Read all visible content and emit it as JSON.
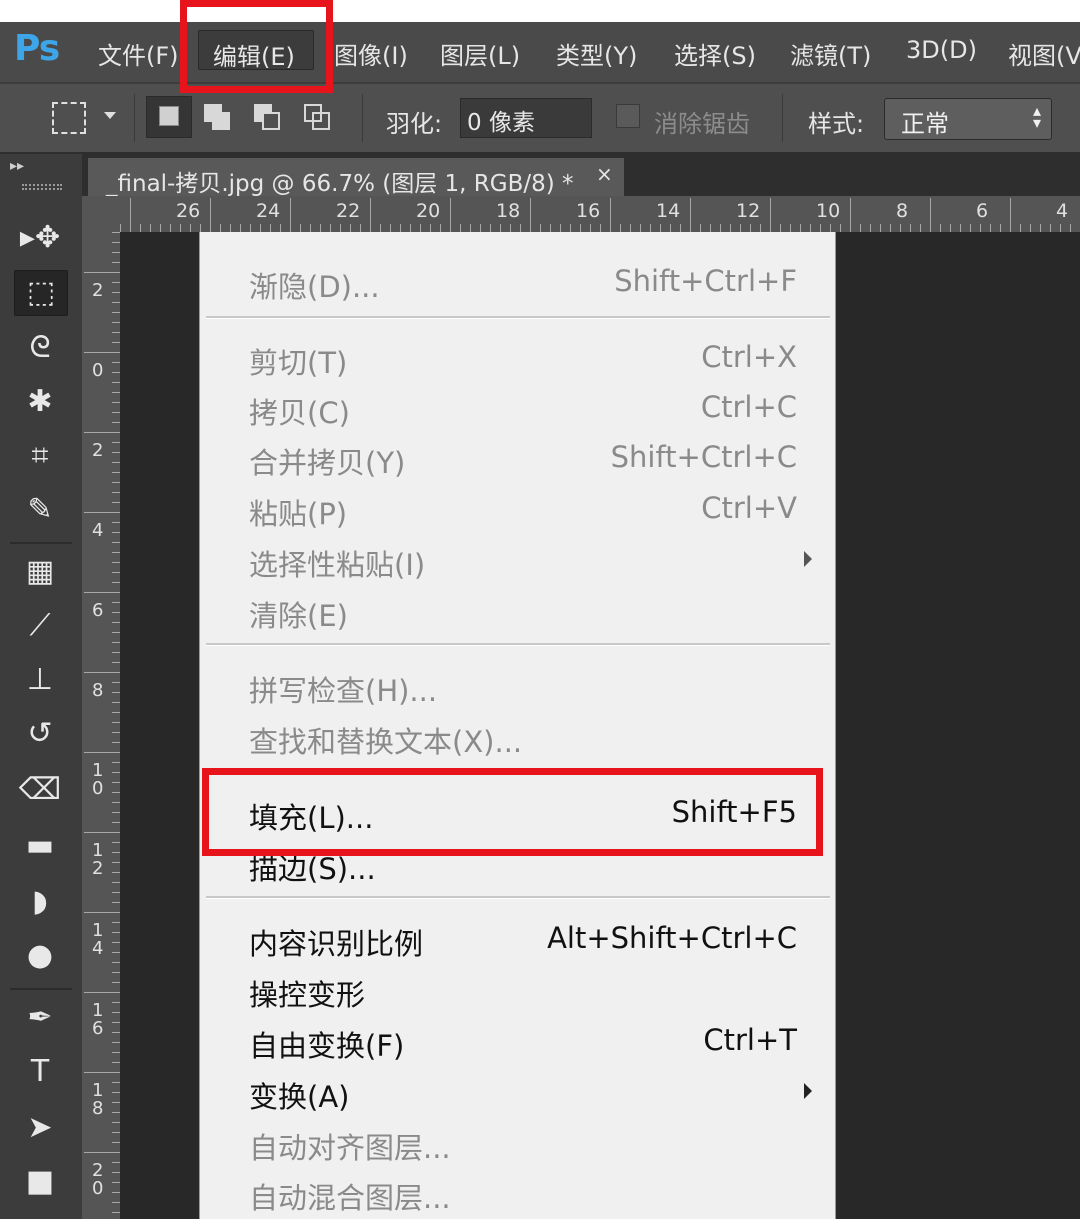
{
  "app": {
    "logo": "Ps"
  },
  "menubar": {
    "items": [
      {
        "label": "文件(F)"
      },
      {
        "label": "编辑(E)"
      },
      {
        "label": "图像(I)"
      },
      {
        "label": "图层(L)"
      },
      {
        "label": "类型(Y)"
      },
      {
        "label": "选择(S)"
      },
      {
        "label": "滤镜(T)"
      },
      {
        "label": "3D(D)"
      },
      {
        "label": "视图(V"
      }
    ]
  },
  "options": {
    "feather_label": "羽化:",
    "feather_value": "0 像素",
    "antialias_label": "消除锯齿",
    "antialias_checked": false,
    "style_label": "样式:",
    "style_value": "正常"
  },
  "document": {
    "tab_title": "_final-拷贝.jpg @ 66.7% (图层 1, RGB/8) *",
    "close_glyph": "×"
  },
  "ruler": {
    "top_numbers": [
      "26",
      "24",
      "22",
      "20",
      "18",
      "16",
      "14",
      "12",
      "10",
      "8",
      "6",
      "4"
    ],
    "left_numbers": [
      "2",
      "0",
      "2",
      "4",
      "6",
      "8",
      "10",
      "12",
      "14",
      "16",
      "18",
      "20"
    ]
  },
  "tools": [
    {
      "name": "move-tool-icon",
      "glyph": "▸✥"
    },
    {
      "name": "rect-marquee-tool-icon",
      "glyph": "⬚"
    },
    {
      "name": "lasso-tool-icon",
      "glyph": "ᘓ"
    },
    {
      "name": "magic-wand-tool-icon",
      "glyph": "✱"
    },
    {
      "name": "crop-tool-icon",
      "glyph": "⌗"
    },
    {
      "name": "eyedropper-tool-icon",
      "glyph": "✎"
    },
    {
      "name": "healing-brush-tool-icon",
      "glyph": "▦"
    },
    {
      "name": "brush-tool-icon",
      "glyph": "⟋"
    },
    {
      "name": "clone-stamp-tool-icon",
      "glyph": "⊥"
    },
    {
      "name": "history-brush-tool-icon",
      "glyph": "↺"
    },
    {
      "name": "eraser-tool-icon",
      "glyph": "⌫"
    },
    {
      "name": "gradient-tool-icon",
      "glyph": "▬"
    },
    {
      "name": "blur-tool-icon",
      "glyph": "◗"
    },
    {
      "name": "dodge-tool-icon",
      "glyph": "●"
    },
    {
      "name": "pen-tool-icon",
      "glyph": "✒"
    },
    {
      "name": "type-tool-icon",
      "glyph": "T"
    },
    {
      "name": "path-select-tool-icon",
      "glyph": "➤"
    },
    {
      "name": "rectangle-shape-tool-icon",
      "glyph": "■"
    }
  ],
  "edit_menu": {
    "items": [
      {
        "label": "渐隐(D)...",
        "shortcut": "Shift+Ctrl+F",
        "enabled": false
      },
      {
        "label": "剪切(T)",
        "shortcut": "Ctrl+X",
        "enabled": false
      },
      {
        "label": "拷贝(C)",
        "shortcut": "Ctrl+C",
        "enabled": false
      },
      {
        "label": "合并拷贝(Y)",
        "shortcut": "Shift+Ctrl+C",
        "enabled": false
      },
      {
        "label": "粘贴(P)",
        "shortcut": "Ctrl+V",
        "enabled": false
      },
      {
        "label": "选择性粘贴(I)",
        "shortcut": "",
        "enabled": false,
        "submenu": true
      },
      {
        "label": "清除(E)",
        "shortcut": "",
        "enabled": false
      },
      {
        "label": "拼写检查(H)...",
        "shortcut": "",
        "enabled": false
      },
      {
        "label": "查找和替换文本(X)...",
        "shortcut": "",
        "enabled": false
      },
      {
        "label": "填充(L)...",
        "shortcut": "Shift+F5",
        "enabled": true
      },
      {
        "label": "描边(S)...",
        "shortcut": "",
        "enabled": true
      },
      {
        "label": "内容识别比例",
        "shortcut": "Alt+Shift+Ctrl+C",
        "enabled": true
      },
      {
        "label": "操控变形",
        "shortcut": "",
        "enabled": true
      },
      {
        "label": "自由变换(F)",
        "shortcut": "Ctrl+T",
        "enabled": true
      },
      {
        "label": "变换(A)",
        "shortcut": "",
        "enabled": true,
        "submenu": true
      },
      {
        "label": "自动对齐图层...",
        "shortcut": "",
        "enabled": false
      },
      {
        "label": "自动混合图层...",
        "shortcut": "",
        "enabled": false
      }
    ]
  },
  "colors": {
    "highlight": "#e8141b",
    "ps_blue": "#3ea6e8",
    "menubar": "#4a4a4a",
    "menu_bg": "#f0f0f0"
  }
}
